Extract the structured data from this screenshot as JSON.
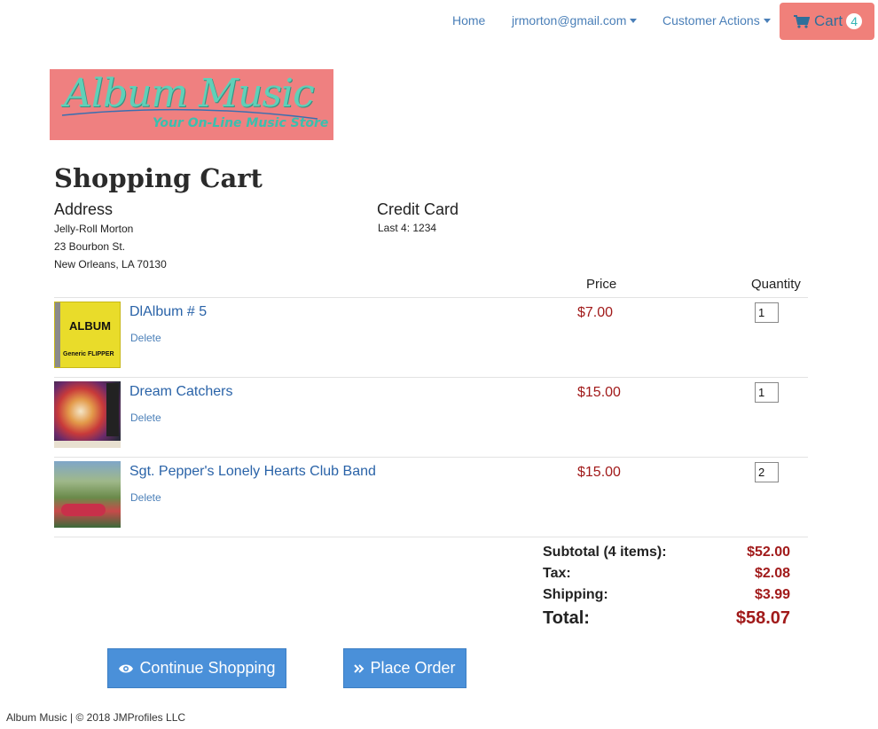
{
  "nav": {
    "home": "Home",
    "user": "jrmorton@gmail.com",
    "customer_actions": "Customer Actions",
    "cart_label": "Cart",
    "cart_count": "4"
  },
  "logo": {
    "title": "Album Music",
    "tagline": "Your On-Line Music Store"
  },
  "page_title": "Shopping Cart",
  "address": {
    "heading": "Address",
    "name": "Jelly-Roll Morton",
    "street": "23 Bourbon St.",
    "city": "New Orleans, LA 70130"
  },
  "credit_card": {
    "heading": "Credit Card",
    "last4": "Last 4: 1234"
  },
  "columns": {
    "price": "Price",
    "quantity": "Quantity"
  },
  "items": [
    {
      "title": "DlAlbum # 5",
      "delete": "Delete",
      "price": "$7.00",
      "quantity": "1",
      "cover_text": "ALBUM",
      "cover_sub": "Generic FLIPPER"
    },
    {
      "title": "Dream Catchers",
      "delete": "Delete",
      "price": "$15.00",
      "quantity": "1"
    },
    {
      "title": "Sgt. Pepper's Lonely Hearts Club Band",
      "delete": "Delete",
      "price": "$15.00",
      "quantity": "2"
    }
  ],
  "summary": {
    "subtotal_label": "Subtotal (4 items):",
    "subtotal": "$52.00",
    "tax_label": "Tax:",
    "tax": "$2.08",
    "shipping_label": "Shipping:",
    "shipping": "$3.99",
    "total_label": "Total:",
    "total": "$58.07"
  },
  "buttons": {
    "continue": "Continue Shopping",
    "place_order": "Place Order"
  },
  "footer": "Album Music | © 2018 JMProfiles LLC",
  "colors": {
    "accent": "#4a90d9",
    "cart_button": "#f0807a",
    "price": "#a11a1a",
    "link": "#2a63a8"
  }
}
